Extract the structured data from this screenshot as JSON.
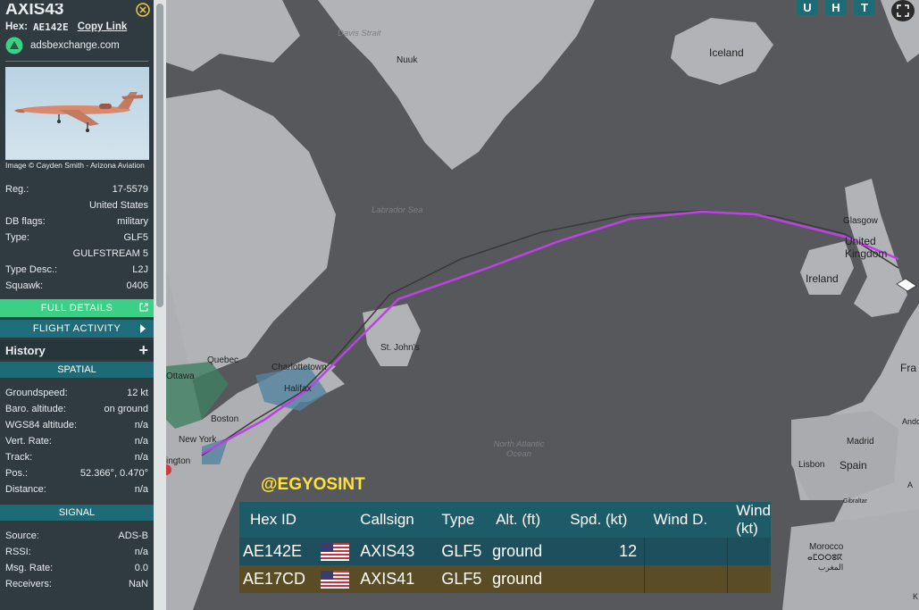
{
  "sidebar": {
    "callsign": "AXIS43",
    "hex_label": "Hex:",
    "hex_value": "AE142E",
    "copy_link": "Copy Link",
    "source_site": "adsbexchange.com",
    "image_credit": "Image © Cayden Smith - Arizona Aviation",
    "details": [
      {
        "label": "Reg.:",
        "value": "17-5579"
      },
      {
        "label": "",
        "value": "United States"
      },
      {
        "label": "DB flags:",
        "value": "military"
      },
      {
        "label": "Type:",
        "value": "GLF5"
      },
      {
        "label": "",
        "value": "GULFSTREAM 5"
      },
      {
        "label": "Type Desc.:",
        "value": "L2J"
      },
      {
        "label": "Squawk:",
        "value": "0406"
      }
    ],
    "full_details": "FULL DETAILS",
    "flight_activity": "FLIGHT ACTIVITY",
    "history": "History",
    "spatial_title": "SPATIAL",
    "spatial": [
      {
        "label": "Groundspeed:",
        "value": "12 kt"
      },
      {
        "label": "Baro. altitude:",
        "value": "on ground"
      },
      {
        "label": "WGS84 altitude:",
        "value": "n/a"
      },
      {
        "label": "Vert. Rate:",
        "value": "n/a"
      },
      {
        "label": "Track:",
        "value": "n/a"
      },
      {
        "label": "Pos.:",
        "value": "52.366°, 0.470°"
      },
      {
        "label": "Distance:",
        "value": "n/a"
      }
    ],
    "signal_title": "SIGNAL",
    "signal": [
      {
        "label": "Source:",
        "value": "ADS-B"
      },
      {
        "label": "RSSI:",
        "value": "n/a"
      },
      {
        "label": "Msg. Rate:",
        "value": "0.0"
      },
      {
        "label": "Receivers:",
        "value": "NaN"
      }
    ]
  },
  "map": {
    "buttons": [
      "U",
      "H",
      "T"
    ],
    "labels": {
      "davis": "Davis Strait",
      "nuuk": "Nuuk",
      "iceland": "Iceland",
      "labrador": "Labrador Sea",
      "glasgow": "Glasgow",
      "uk": "United Kingdom",
      "ireland": "Ireland",
      "stjohns": "St. John's",
      "quebec": "Quebec",
      "ottawa": "Ottawa",
      "charlottetown": "Charlottetown",
      "halifax": "Halifax",
      "boston": "Boston",
      "newyork": "New York",
      "washington": "ington",
      "atlantic": "North Atlantic Ocean",
      "madrid": "Madrid",
      "lisbon": "Lisbon",
      "spain": "Spain",
      "gibraltar": "Gibraltar",
      "morocco": "Morocco",
      "morocco_local": "ⴰⵎⵔⵔⵓⴽ",
      "morocco_ar": "المغرب",
      "fra": "Fra",
      "ando": "Ando",
      "alg": "A",
      "kinz": "K",
      "tifinagh": "ⵣ"
    },
    "track_color": "#c040e8",
    "track2_color": "#4a4a4a"
  },
  "overlay": {
    "handle": "@EGYOSINT",
    "headers": [
      "Hex ID",
      "",
      "Callsign",
      "Type",
      "Alt. (ft)",
      "Spd. (kt)",
      "Wind D.",
      "Wind (kt)"
    ],
    "rows": [
      {
        "hex": "AE142E",
        "flag": "us-flag",
        "callsign": "AXIS43",
        "type": "GLF5",
        "alt": "ground",
        "spd": "12",
        "windd": "",
        "wind": ""
      },
      {
        "hex": "AE17CD",
        "flag": "us-flag",
        "callsign": "AXIS41",
        "type": "GLF5",
        "alt": "ground",
        "spd": "",
        "windd": "",
        "wind": ""
      }
    ]
  }
}
